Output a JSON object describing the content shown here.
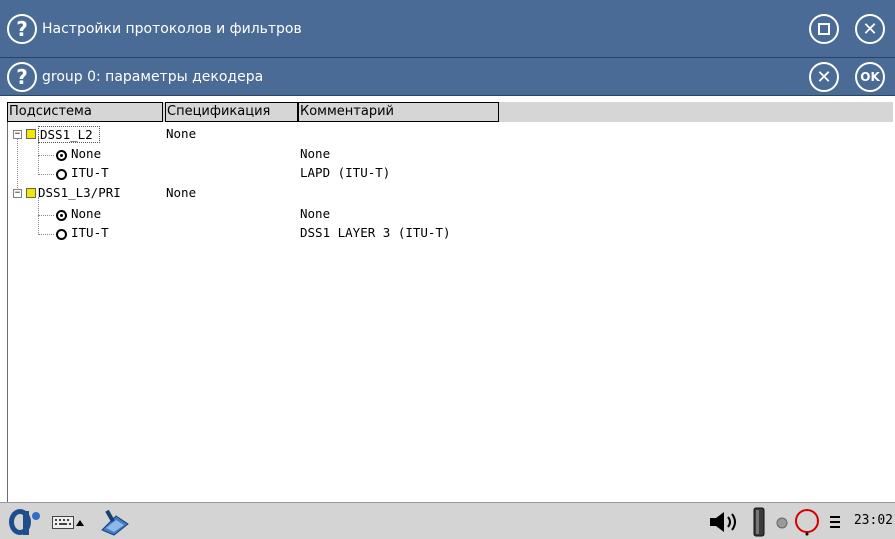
{
  "window": {
    "title": "Настройки протоколов и фильтров"
  },
  "dialog": {
    "title": "group 0: параметры декодера",
    "ok_label": "OK"
  },
  "table": {
    "columns": [
      "Подсистема",
      "Спецификация",
      "Комментарий"
    ],
    "rows": [
      {
        "name": "DSS1_L2",
        "spec": "None",
        "comment": ""
      },
      {
        "name": "None",
        "spec": "",
        "comment": "None",
        "selected": true
      },
      {
        "name": "ITU-T",
        "spec": "",
        "comment": "LAPD (ITU-T)",
        "selected": false
      },
      {
        "name": "DSS1_L3/PRI",
        "spec": "None",
        "comment": ""
      },
      {
        "name": "None",
        "spec": "",
        "comment": "None",
        "selected": true
      },
      {
        "name": "ITU-T",
        "spec": "",
        "comment": "DSS1 LAYER 3 (ITU-T)",
        "selected": false
      }
    ]
  },
  "taskbar": {
    "clock": "23:02"
  },
  "colors": {
    "titlebar": "#4a6b95",
    "header": "#d6d6d6",
    "taskbar": "#d4d4d4",
    "tree_box": "#f0e800"
  }
}
